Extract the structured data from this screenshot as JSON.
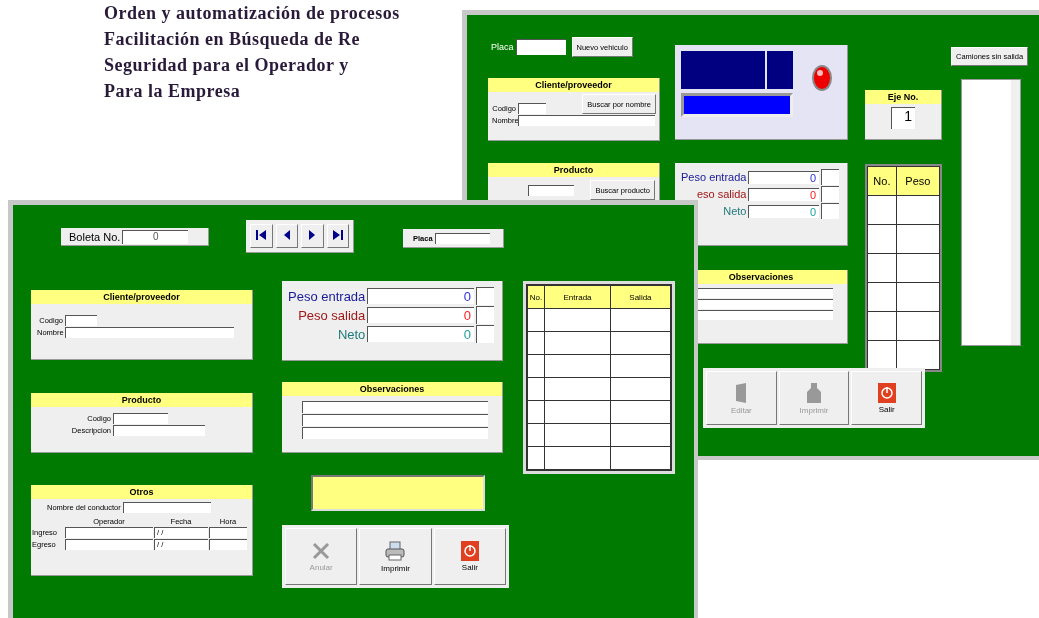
{
  "document": {
    "lines": [
      "Orden y automatización de procesos",
      "Facilitación en Búsqueda de Re",
      "Seguridad para el Operador y",
      "Para la Empresa"
    ]
  },
  "back_window": {
    "placa_label": "Placa",
    "new_vehicle_button": "Nuevo vehiculo",
    "client_panel": {
      "title": "Cliente/proveedor",
      "code_label": "Codigo",
      "name_label": "Nombre",
      "search_button": "Buscar por nombre"
    },
    "axle_panel": {
      "title": "Eje No.",
      "value": "1"
    },
    "trucks_button": "Camiones sin salida",
    "product_panel": {
      "title": "Producto",
      "search_button": "Buscar producto"
    },
    "weights": [
      {
        "label": "Peso entrada",
        "value": "0",
        "kind": "entrada"
      },
      {
        "label": "eso salida",
        "value": "0",
        "kind": "salida"
      },
      {
        "label": "Neto",
        "value": "0",
        "kind": "neto"
      }
    ],
    "axle_table": {
      "columns": [
        "No.",
        "Peso"
      ]
    },
    "observations_title": "Observaciones",
    "buttons": [
      {
        "label": "Editar",
        "kind": "edit",
        "disabled": true
      },
      {
        "label": "Imprimir",
        "kind": "weight",
        "disabled": true
      },
      {
        "label": "Salir",
        "kind": "exit",
        "disabled": false
      }
    ]
  },
  "front_window": {
    "ticket_label": "Boleta No.",
    "ticket_value": "0",
    "placa_label": "Placa",
    "client_panel": {
      "title": "Cliente/proveedor",
      "code_label": "Codigo",
      "name_label": "Nombre"
    },
    "weights": [
      {
        "label": "Peso entrada",
        "value": "0",
        "kind": "entrada"
      },
      {
        "label": "Peso salida",
        "value": "0",
        "kind": "salida"
      },
      {
        "label": "Neto",
        "value": "0",
        "kind": "neto"
      }
    ],
    "ticket_table": {
      "columns": [
        "No.",
        "Entrada",
        "Salida"
      ]
    },
    "product_panel": {
      "title": "Producto",
      "code_label": "Codigo",
      "description_label": "Descripcion"
    },
    "observations_title": "Observaciones",
    "others_panel": {
      "title": "Otros",
      "driver_label": "Nombre del conductor",
      "columns": [
        "Operador",
        "Fecha",
        "Hora"
      ],
      "rows": [
        {
          "label": "Ingreso",
          "date": "/ /"
        },
        {
          "label": "Egreso",
          "date": "/ /"
        }
      ]
    },
    "buttons": [
      {
        "label": "Anular",
        "kind": "cancel",
        "disabled": true
      },
      {
        "label": "Imprimir",
        "kind": "print",
        "disabled": false
      },
      {
        "label": "Salir",
        "kind": "exit",
        "disabled": false
      }
    ]
  }
}
